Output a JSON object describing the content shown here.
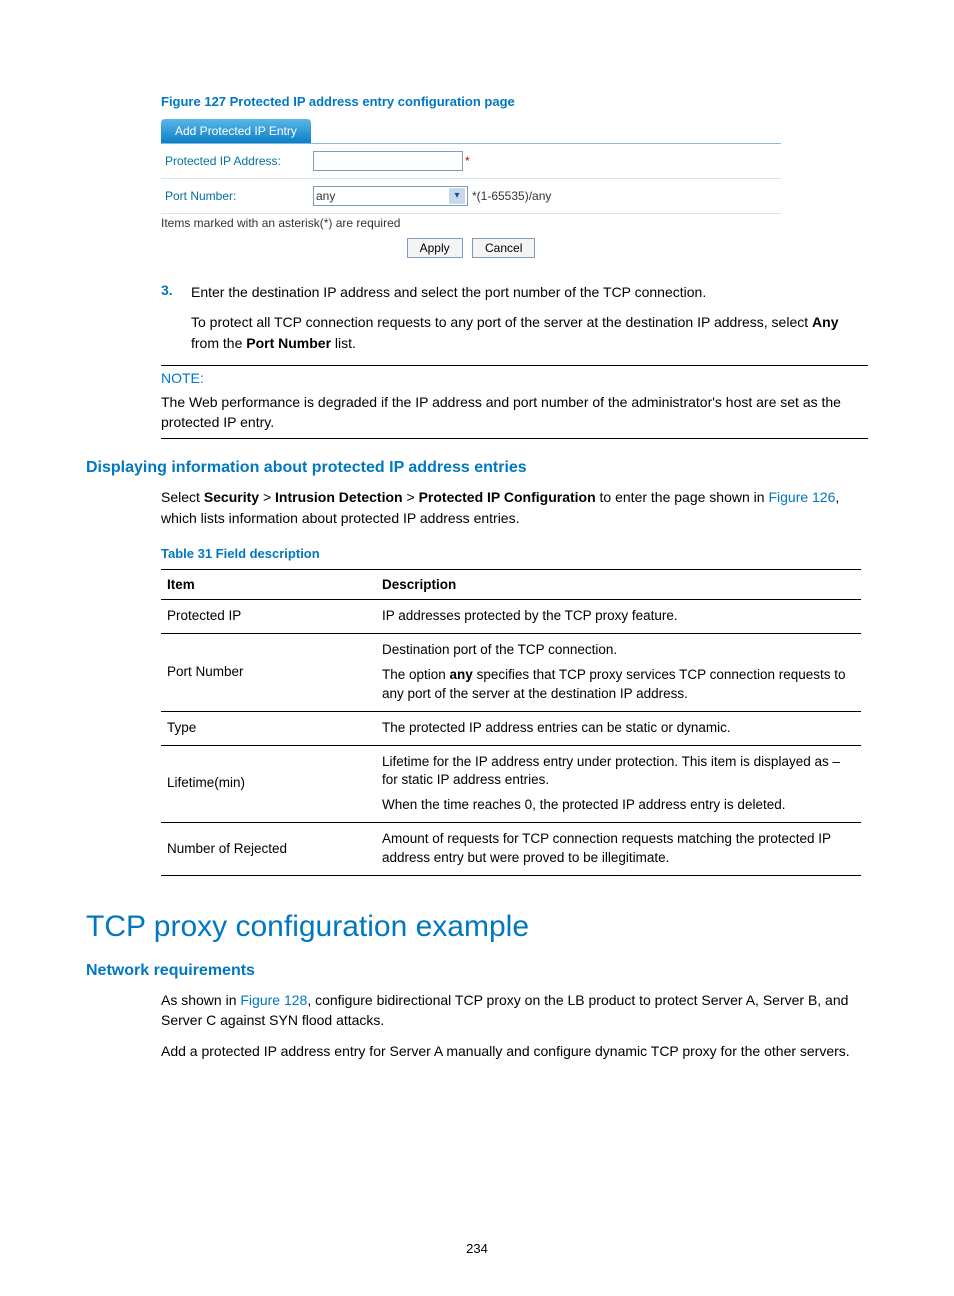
{
  "figure_caption": "Figure 127 Protected IP address entry configuration page",
  "panel": {
    "tab_label": "Add Protected IP Entry",
    "row1_label": "Protected IP Address:",
    "row1_value": "",
    "row2_label": "Port Number:",
    "row2_value": "any",
    "row2_hint": "*(1-65535)/any",
    "items_note": "Items marked with an asterisk(*) are required",
    "apply_label": "Apply",
    "cancel_label": "Cancel"
  },
  "step3": {
    "num": "3.",
    "line1": "Enter the destination IP address and select the port number of the TCP connection.",
    "line2_a": "To protect all TCP connection requests to any port of the server at the destination IP address, select ",
    "line2_b": "Any",
    "line2_c": " from the ",
    "line2_d": "Port Number",
    "line2_e": " list."
  },
  "note": {
    "label": "NOTE:",
    "body": "The Web performance is degraded if the IP address and port number of the administrator's host are set as the protected IP entry."
  },
  "h3_display": "Displaying information about protected IP address entries",
  "display_para": {
    "a": "Select ",
    "b": "Security",
    "gt": " > ",
    "c": "Intrusion Detection",
    "d": "Protected IP Configuration",
    "e": " to enter the page shown in ",
    "link": "Figure 126",
    "f": ", which lists information about protected IP address entries."
  },
  "table_caption": "Table 31 Field description",
  "table": {
    "head_item": "Item",
    "head_desc": "Description",
    "rows": [
      {
        "item": "Protected IP",
        "desc": [
          {
            "t": "IP addresses protected by the TCP proxy feature."
          }
        ]
      },
      {
        "item": "Port Number",
        "desc": [
          {
            "t": "Destination port of the TCP connection."
          },
          {
            "pre": "The option ",
            "bold": "any",
            "post": " specifies that TCP proxy services TCP connection requests to any port of the server at the destination IP address."
          }
        ]
      },
      {
        "item": "Type",
        "desc": [
          {
            "t": "The protected IP address entries can be static or dynamic."
          }
        ]
      },
      {
        "item": "Lifetime(min)",
        "desc": [
          {
            "t": "Lifetime for the IP address entry under protection. This item is displayed as – for static IP address entries."
          },
          {
            "t": "When the time reaches 0, the protected IP address entry is deleted."
          }
        ]
      },
      {
        "item": "Number of Rejected",
        "desc": [
          {
            "t": "Amount of requests for TCP connection requests matching the protected IP address entry but were proved to be illegitimate."
          }
        ]
      }
    ]
  },
  "h1": "TCP proxy configuration example",
  "h3_netreq": "Network requirements",
  "netreq": {
    "p1_a": "As shown in ",
    "p1_link": "Figure 128",
    "p1_b": ", configure bidirectional TCP proxy on the LB product to protect Server A, Server B, and Server C against SYN flood attacks.",
    "p2": "Add a protected IP address entry for Server A manually and configure dynamic TCP proxy for the other servers."
  },
  "page_number": "234"
}
